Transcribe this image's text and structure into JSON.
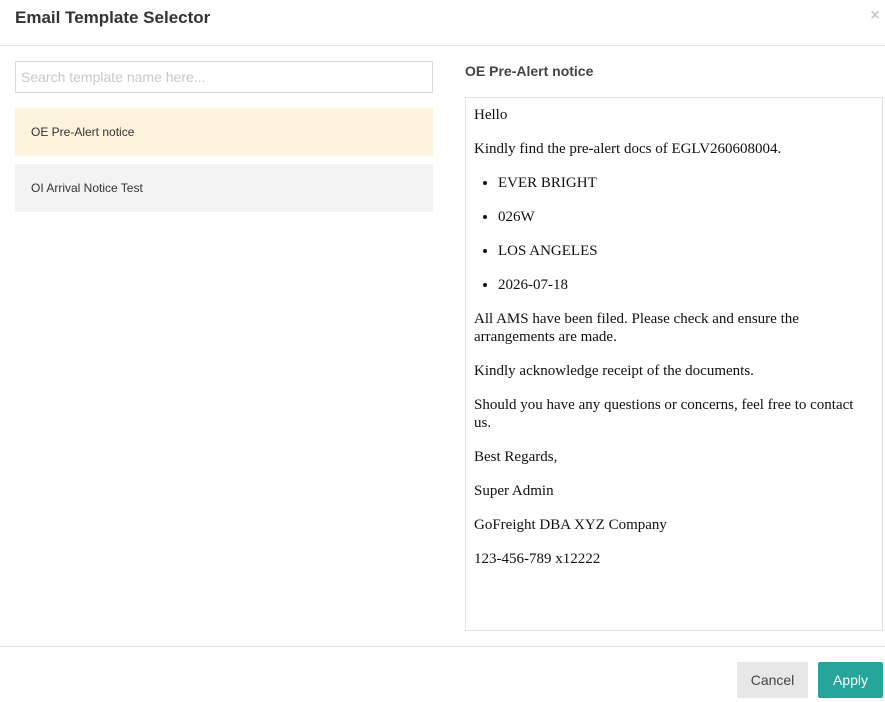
{
  "header": {
    "title": "Email Template Selector",
    "close_label": "×"
  },
  "search": {
    "value": "",
    "placeholder": "Search template name here..."
  },
  "templates": [
    {
      "label": "OE Pre-Alert notice",
      "selected": true
    },
    {
      "label": "OI Arrival Notice Test",
      "selected": false
    }
  ],
  "preview": {
    "title": "OE Pre-Alert notice",
    "greeting": "Hello",
    "intro": "Kindly find the pre-alert docs of EGLV260608004.",
    "bullets": [
      "EVER BRIGHT",
      "026W",
      "LOS ANGELES",
      "2026-07-18"
    ],
    "line1": "All AMS have been filed. Please check and ensure the arrangements are made.",
    "line2": "Kindly acknowledge receipt of the documents.",
    "line3": "Should you have any questions or concerns, feel free to contact us.",
    "closing": "Best Regards,",
    "signer": "Super Admin",
    "company": "GoFreight DBA XYZ Company",
    "phone": "123-456-789 x12222"
  },
  "footer": {
    "cancel_label": "Cancel",
    "apply_label": "Apply"
  },
  "colors": {
    "accent": "#26a69a",
    "selected_bg": "#fef3dc",
    "item_bg": "#f3f3f3"
  }
}
